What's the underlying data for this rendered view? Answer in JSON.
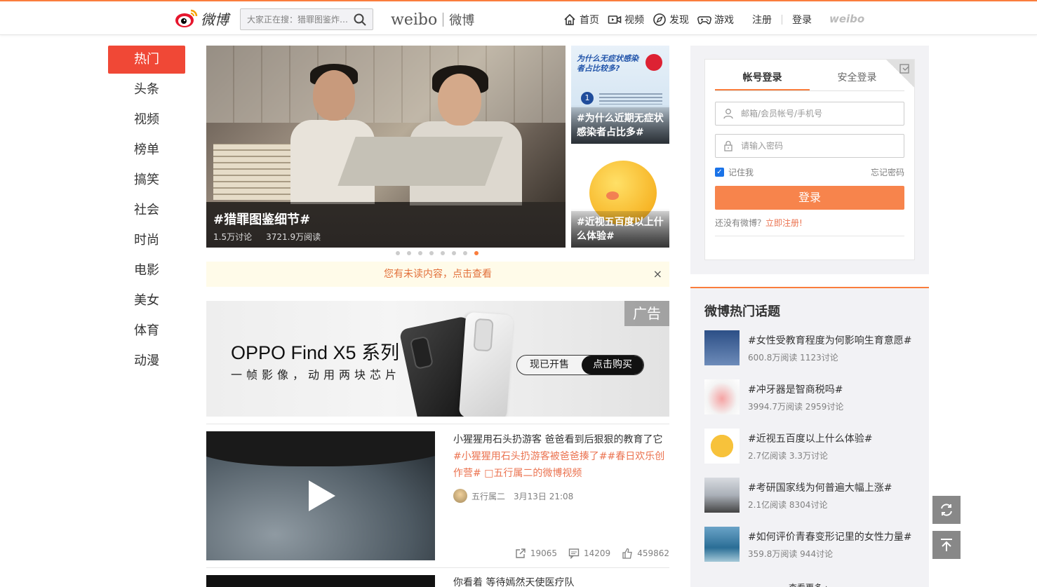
{
  "header": {
    "logo_text": "微博",
    "search_placeholder": "大家正在搜：猎罪图鉴炸…",
    "brand_en": "weibo",
    "brand_cn": "微博",
    "nav": [
      {
        "label": "首页",
        "icon": "home-icon"
      },
      {
        "label": "视频",
        "icon": "video-icon"
      },
      {
        "label": "发现",
        "icon": "compass-icon"
      },
      {
        "label": "游戏",
        "icon": "gamepad-icon"
      }
    ],
    "register": "注册",
    "login": "登录",
    "weibo_mark": "weibo"
  },
  "left_nav": {
    "items": [
      "热门",
      "头条",
      "视频",
      "榜单",
      "搞笑",
      "社会",
      "时尚",
      "电影",
      "美女",
      "体育",
      "动漫"
    ],
    "active_index": 0
  },
  "carousel": {
    "main": {
      "title": "#猎罪图鉴细节#",
      "discuss": "1.5万讨论",
      "reads": "3721.9万阅读"
    },
    "side": [
      {
        "caption": "#为什么近期无症状感染者占比多#",
        "image_text": "为什么无症状感染者占比较多?",
        "badge": "1"
      },
      {
        "caption": "#近视五百度以上什么体验#"
      }
    ],
    "dot_count": 8,
    "active_dot": 7
  },
  "notice": {
    "text": "您有未读内容，点击查看",
    "close": "×"
  },
  "ad": {
    "title": "OPPO Find X5 系列",
    "subtitle": "一帧影像，动用两块芯片",
    "presale": "现已开售",
    "buy": "点击购买",
    "tag": "广告"
  },
  "feed": [
    {
      "text": "小猩猩用石头扔游客 爸爸看到后狠狠的教育了它 ",
      "tags": "#小猩猩用石头扔游客被爸爸揍了##春日欢乐创作营# ",
      "link": "□五行属二的微博视频",
      "author": "五行属二",
      "time": "3月13日 21:08",
      "reposts": "19065",
      "comments": "14209",
      "likes": "459862"
    },
    {
      "text": "你看着 等待嫣然天使医疗队"
    }
  ],
  "login": {
    "tabs": [
      "帐号登录",
      "安全登录"
    ],
    "active_tab": 0,
    "username_placeholder": "邮箱/会员帐号/手机号",
    "password_placeholder": "请输入密码",
    "remember": "记住我",
    "forgot": "忘记密码",
    "submit": "登录",
    "no_account": "还没有微博？",
    "register_now": "立即注册!"
  },
  "hot_topics": {
    "title": "微博热门话题",
    "items": [
      {
        "title": "#女性受教育程度为何影响生育意愿#",
        "stats": "600.8万阅读 1123讨论"
      },
      {
        "title": "#冲牙器是智商税吗#",
        "stats": "3994.7万阅读 2959讨论"
      },
      {
        "title": "#近视五百度以上什么体验#",
        "stats": "2.7亿阅读 3.3万讨论"
      },
      {
        "title": "#考研国家线为何普遍大幅上涨#",
        "stats": "2.1亿阅读 8304讨论"
      },
      {
        "title": "#如何评价青春变形记里的女性力量#",
        "stats": "359.8万阅读 944讨论"
      }
    ],
    "more": "查看更多 ›"
  },
  "colors": {
    "accent": "#fa7d3c",
    "active_nav": "#f04836",
    "link": "#eb7350"
  }
}
